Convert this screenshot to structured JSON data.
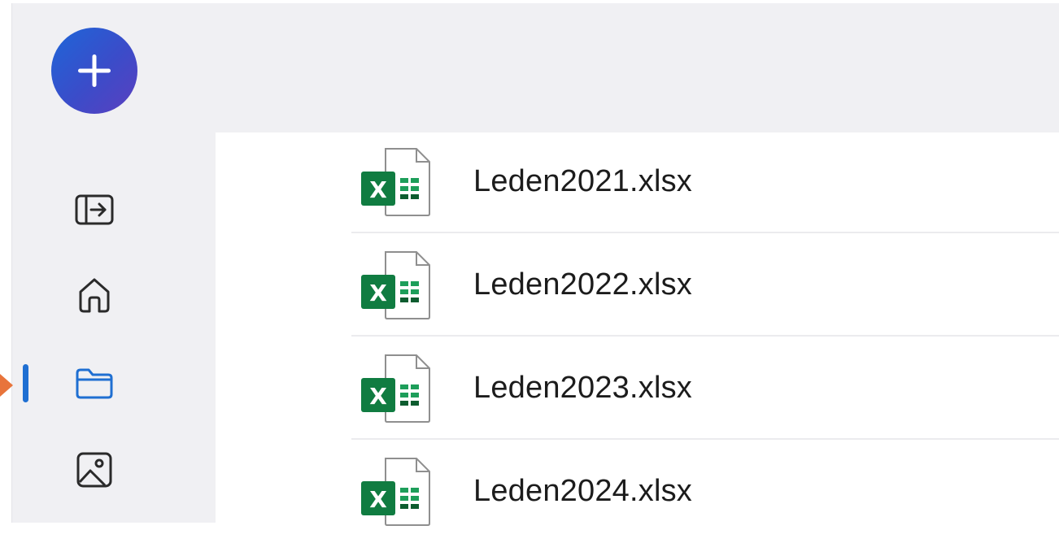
{
  "sidebar": {
    "new_icon": "plus-icon",
    "items": [
      {
        "id": "collapse",
        "icon": "panel-expand-icon"
      },
      {
        "id": "home",
        "icon": "home-icon"
      },
      {
        "id": "files",
        "icon": "folder-icon",
        "active": true
      },
      {
        "id": "photos",
        "icon": "image-icon"
      }
    ]
  },
  "files": [
    {
      "name": "Leden2021.xlsx",
      "icon": "excel-file-icon"
    },
    {
      "name": "Leden2022.xlsx",
      "icon": "excel-file-icon"
    },
    {
      "name": "Leden2023.xlsx",
      "icon": "excel-file-icon"
    },
    {
      "name": "Leden2024.xlsx",
      "icon": "excel-file-icon"
    }
  ],
  "colors": {
    "accent": "#1f6fd2",
    "fab_gradient_start": "#1e66d8",
    "fab_gradient_end": "#5b3fbf",
    "excel_green": "#107c41",
    "marker": "#e8743b"
  }
}
